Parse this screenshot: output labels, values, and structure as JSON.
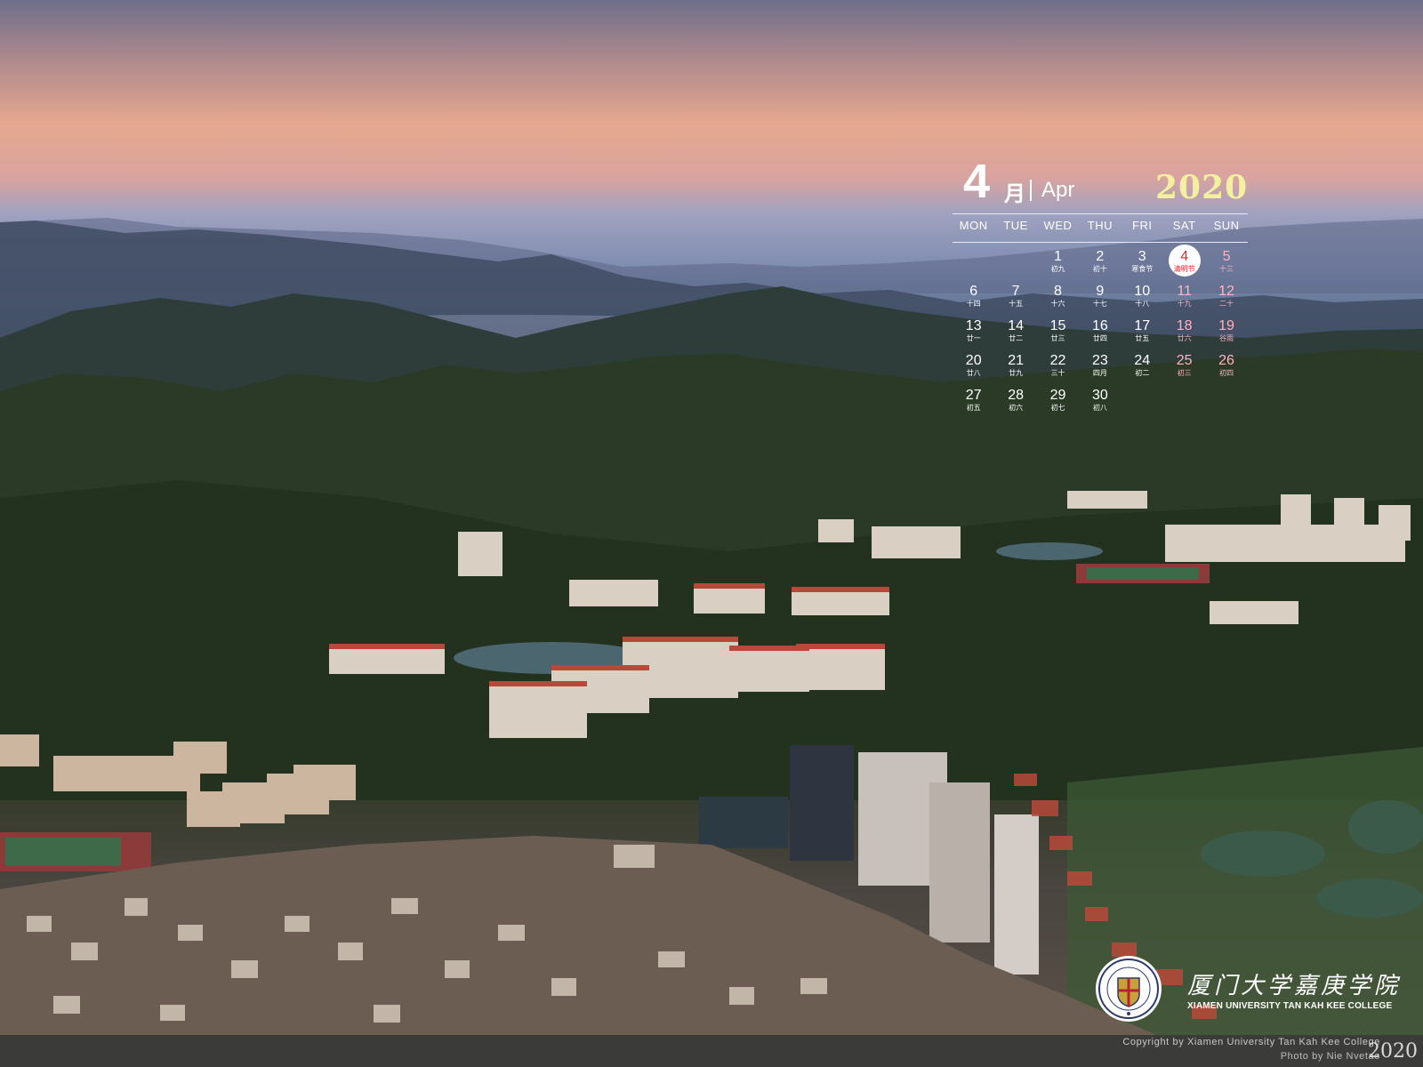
{
  "calendar": {
    "month_number": "4",
    "month_cn": "月",
    "month_en": "Apr",
    "year": "2020",
    "weekdays": [
      "MON",
      "TUE",
      "WED",
      "THU",
      "FRI",
      "SAT",
      "SUN"
    ],
    "today": "4",
    "rows": [
      [
        null,
        null,
        {
          "d": "1",
          "l": "初九"
        },
        {
          "d": "2",
          "l": "初十"
        },
        {
          "d": "3",
          "l": "寒食节"
        },
        {
          "d": "4",
          "l": "清明节"
        },
        {
          "d": "5",
          "l": "十三"
        }
      ],
      [
        {
          "d": "6",
          "l": "十四"
        },
        {
          "d": "7",
          "l": "十五"
        },
        {
          "d": "8",
          "l": "十六"
        },
        {
          "d": "9",
          "l": "十七"
        },
        {
          "d": "10",
          "l": "十八"
        },
        {
          "d": "11",
          "l": "十九"
        },
        {
          "d": "12",
          "l": "二十"
        }
      ],
      [
        {
          "d": "13",
          "l": "廿一"
        },
        {
          "d": "14",
          "l": "廿二"
        },
        {
          "d": "15",
          "l": "廿三"
        },
        {
          "d": "16",
          "l": "廿四"
        },
        {
          "d": "17",
          "l": "廿五"
        },
        {
          "d": "18",
          "l": "廿六"
        },
        {
          "d": "19",
          "l": "谷雨"
        }
      ],
      [
        {
          "d": "20",
          "l": "廿八"
        },
        {
          "d": "21",
          "l": "廿九"
        },
        {
          "d": "22",
          "l": "三十"
        },
        {
          "d": "23",
          "l": "四月"
        },
        {
          "d": "24",
          "l": "初二"
        },
        {
          "d": "25",
          "l": "初三"
        },
        {
          "d": "26",
          "l": "初四"
        }
      ],
      [
        {
          "d": "27",
          "l": "初五"
        },
        {
          "d": "28",
          "l": "初六"
        },
        {
          "d": "29",
          "l": "初七"
        },
        {
          "d": "30",
          "l": "初八"
        },
        null,
        null,
        null
      ]
    ]
  },
  "college": {
    "name_cn": "厦门大学嘉庚学院",
    "name_en": "XIAMEN UNIVERSITY TAN KAH KEE COLLEGE"
  },
  "footer": {
    "copyright": "Copyright by Xiamen University Tan Kah Kee College",
    "photo": "Photo by Nie Nvetao",
    "year": "2020"
  },
  "colors": {
    "year_accent": "#f3f0a0",
    "weekend": "#ffb3c2",
    "today_circle": "#ffffff",
    "today_text": "#e0242e",
    "footer_bg": "#3b3c3a"
  }
}
